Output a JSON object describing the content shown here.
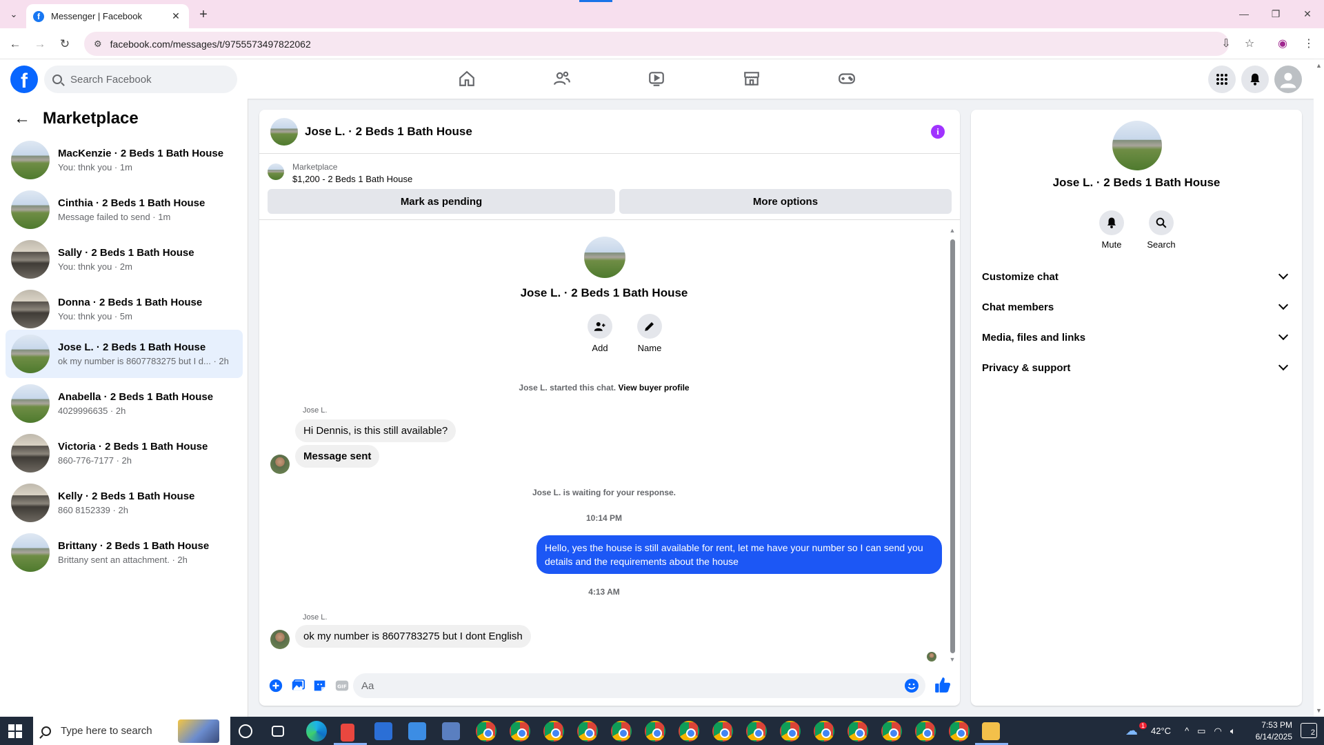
{
  "browser": {
    "tab_title": "Messenger | Facebook",
    "url": "facebook.com/messages/t/9755573497822062",
    "accent": "#1a73e8"
  },
  "fb": {
    "search_placeholder": "Search Facebook",
    "brand_color": "#0866ff",
    "logo_letter": "f"
  },
  "sidebar": {
    "title": "Marketplace",
    "conversations": [
      {
        "name": "MacKenzie · 2 Beds 1 Bath House",
        "snippet": "You: thnk you · 1m"
      },
      {
        "name": "Cinthia · 2 Beds 1 Bath House",
        "snippet": "Message failed to send · 1m"
      },
      {
        "name": "Sally · 2 Beds 1 Bath House",
        "snippet": "You: thnk you · 2m"
      },
      {
        "name": "Donna · 2 Beds 1 Bath House",
        "snippet": "You: thnk you · 5m"
      },
      {
        "name": "Jose L. · 2 Beds 1 Bath House",
        "snippet": "ok my number is 8607783275 but I d... · 2h"
      },
      {
        "name": "Anabella · 2 Beds 1 Bath House",
        "snippet": "4029996635 · 2h"
      },
      {
        "name": "Victoria · 2 Beds 1 Bath House",
        "snippet": "860-776-7177 · 2h"
      },
      {
        "name": "Kelly · 2 Beds 1 Bath House",
        "snippet": "860 8152339 · 2h"
      },
      {
        "name": "Brittany · 2 Beds 1 Bath House",
        "snippet": "Brittany sent an attachment. · 2h"
      }
    ]
  },
  "chat": {
    "title": "Jose L. · 2 Beds 1 Bath House",
    "listing_label": "Marketplace",
    "listing_price": "$1,200 - 2 Beds 1 Bath House",
    "mark_pending": "Mark as pending",
    "more_options": "More options",
    "profile_name": "Jose L. · 2 Beds 1 Bath House",
    "add_label": "Add",
    "name_label": "Name",
    "started_text": "Jose L. started this chat.",
    "view_profile": "View buyer profile",
    "sender1": "Jose L.",
    "msg1": "Hi Dennis, is this still available?",
    "msg2": "Message sent",
    "waiting": "Jose L. is waiting for your response.",
    "time1": "10:14 PM",
    "msg3": "Hello, yes the house is still available for rent, let me have your number so I can send you details and the requirements about the house",
    "time2": "4:13 AM",
    "sender2": "Jose L.",
    "msg4": "ok my number is 8607783275 but I dont English",
    "composer_placeholder": "Aa",
    "bubble_color": "#1c57f5"
  },
  "right": {
    "name": "Jose L. · 2 Beds 1 Bath House",
    "mute": "Mute",
    "search": "Search",
    "rows": [
      "Customize chat",
      "Chat members",
      "Media, files and links",
      "Privacy & support"
    ]
  },
  "taskbar": {
    "search_placeholder": "Type here to search",
    "temp": "42°C",
    "weather_badge": "1",
    "time": "7:53 PM",
    "date": "6/14/2025",
    "notif_count": "2"
  }
}
